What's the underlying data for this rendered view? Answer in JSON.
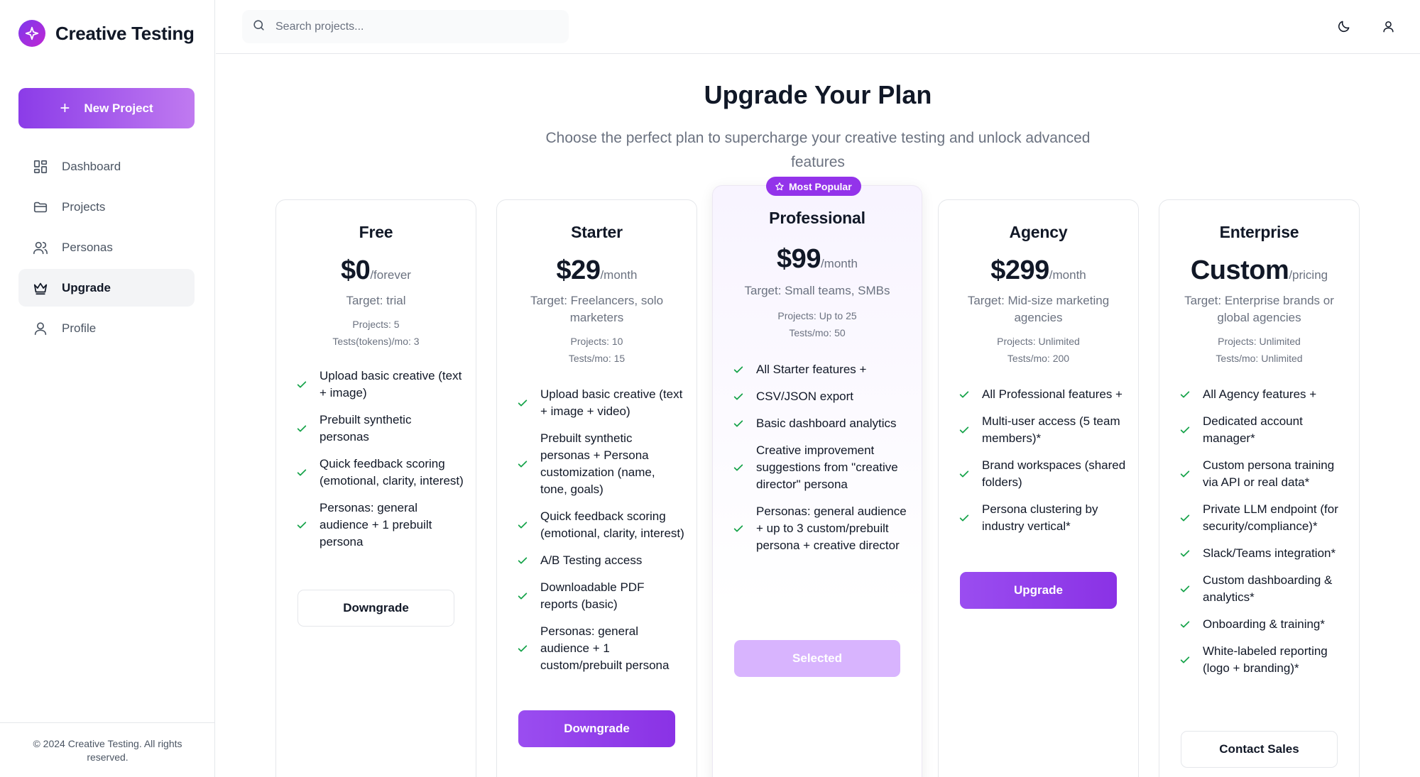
{
  "app": {
    "name": "Creative Testing"
  },
  "sidebar": {
    "new_project": "New Project",
    "items": [
      {
        "label": "Dashboard",
        "icon": "dashboard-icon"
      },
      {
        "label": "Projects",
        "icon": "folder-icon"
      },
      {
        "label": "Personas",
        "icon": "users-icon"
      },
      {
        "label": "Upgrade",
        "icon": "crown-icon",
        "active": true
      },
      {
        "label": "Profile",
        "icon": "user-icon"
      }
    ],
    "footer": "© 2024 Creative Testing. All rights reserved."
  },
  "topbar": {
    "search_placeholder": "Search projects...",
    "icons": [
      "moon-icon",
      "user-icon"
    ]
  },
  "page": {
    "title": "Upgrade Your Plan",
    "subtitle": "Choose the perfect plan to supercharge your creative testing and unlock advanced features"
  },
  "colors": {
    "accent": "#9333ea",
    "check": "#16a34a",
    "button_gradient_start": "#9a4df0",
    "button_gradient_end": "#8a32e5",
    "selected": "#d8b4fe"
  },
  "plans": [
    {
      "name": "Free",
      "price": "$0",
      "period": "/forever",
      "target": "Target: trial",
      "projects": "Projects: 5",
      "tests": "Tests(tokens)/mo: 3",
      "features": [
        "Upload basic creative (text + image)",
        "Prebuilt synthetic personas",
        "Quick feedback scoring (emotional, clarity, interest)",
        "Personas: general audience + 1 prebuilt persona"
      ],
      "button": "Downgrade",
      "button_style": "outline"
    },
    {
      "name": "Starter",
      "price": "$29",
      "period": "/month",
      "target": "Target: Freelancers, solo marketers",
      "projects": "Projects: 10",
      "tests": "Tests/mo: 15",
      "features": [
        "Upload basic creative (text + image + video)",
        "Prebuilt synthetic personas + Persona customization (name, tone, goals)",
        "Quick feedback scoring (emotional, clarity, interest)",
        "A/B Testing access",
        "Downloadable PDF reports (basic)",
        "Personas: general audience + 1 custom/prebuilt persona"
      ],
      "button": "Downgrade",
      "button_style": "primary"
    },
    {
      "name": "Professional",
      "price": "$99",
      "period": "/month",
      "badge": "Most Popular",
      "target": "Target: Small teams, SMBs",
      "projects": "Projects: Up to 25",
      "tests": "Tests/mo: 50",
      "features": [
        "All Starter features +",
        "CSV/JSON export",
        "Basic dashboard analytics",
        "Creative improvement suggestions from \"creative director\" persona",
        "Personas: general audience + up to 3 custom/prebuilt persona + creative director"
      ],
      "button": "Selected",
      "button_style": "disabled"
    },
    {
      "name": "Agency",
      "price": "$299",
      "period": "/month",
      "target": "Target: Mid-size marketing agencies",
      "projects": "Projects: Unlimited",
      "tests": "Tests/mo: 200",
      "features": [
        "All Professional features +",
        "Multi-user access (5 team members)*",
        "Brand workspaces (shared folders)",
        "Persona clustering by industry vertical*"
      ],
      "button": "Upgrade",
      "button_style": "primary"
    },
    {
      "name": "Enterprise",
      "price": "Custom",
      "period": "/pricing",
      "target": "Target: Enterprise brands or global agencies",
      "projects": "Projects: Unlimited",
      "tests": "Tests/mo: Unlimited",
      "features": [
        "All Agency features +",
        "Dedicated account manager*",
        "Custom persona training via API or real data*",
        "Private LLM endpoint (for security/compliance)*",
        "Slack/Teams integration*",
        "Custom dashboarding & analytics*",
        "Onboarding & training*",
        "White-labeled reporting (logo + branding)*"
      ],
      "button": "Contact Sales",
      "button_style": "outline"
    }
  ]
}
